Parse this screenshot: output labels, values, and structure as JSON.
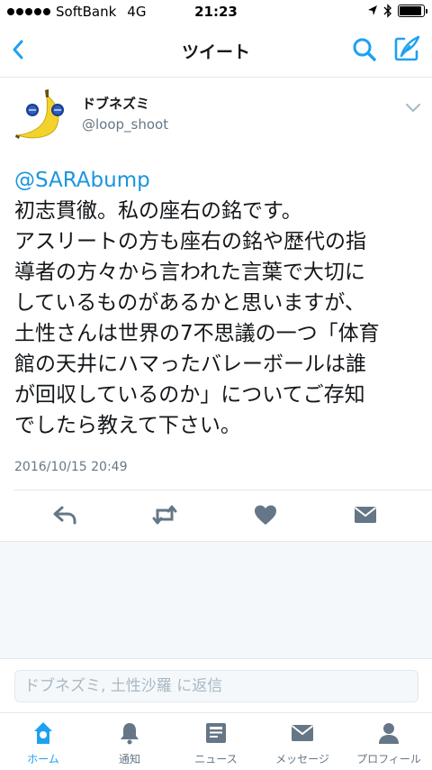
{
  "status_bar": {
    "carrier": "SoftBank",
    "network": "4G",
    "time": "21:23",
    "battery_level": 0.92
  },
  "nav": {
    "title": "ツイート",
    "back_icon": "chevron-left-icon",
    "search_icon": "search-icon",
    "compose_icon": "compose-icon"
  },
  "tweet": {
    "display_name": "ドブネズミ",
    "username": "@loop_shoot",
    "mention": "@SARAbump",
    "lines": [
      "初志貫徹。私の座右の銘です。",
      "アスリートの方も座右の銘や歴代の指",
      "導者の方々から言われた言葉で大切に",
      "しているものがあるかと思いますが、",
      "土性さんは世界の7不思議の一つ「体育",
      "館の天井にハマったバレーボールは誰",
      "が回収しているのか」についてご存知",
      "でしたら教えて下さい。"
    ],
    "timestamp": "2016/10/15 20:49"
  },
  "reply": {
    "placeholder": "ドブネズミ, 土性沙羅 に返信"
  },
  "tabs": [
    {
      "label": "ホーム",
      "icon": "home-icon",
      "active": true
    },
    {
      "label": "通知",
      "icon": "bell-icon",
      "active": false
    },
    {
      "label": "ニュース",
      "icon": "news-icon",
      "active": false
    },
    {
      "label": "メッセージ",
      "icon": "envelope-icon",
      "active": false
    },
    {
      "label": "プロフィール",
      "icon": "person-icon",
      "active": false
    }
  ],
  "colors": {
    "accent": "#1da1f2",
    "text": "#14171a",
    "muted": "#657786",
    "icon_grey": "#657786"
  }
}
